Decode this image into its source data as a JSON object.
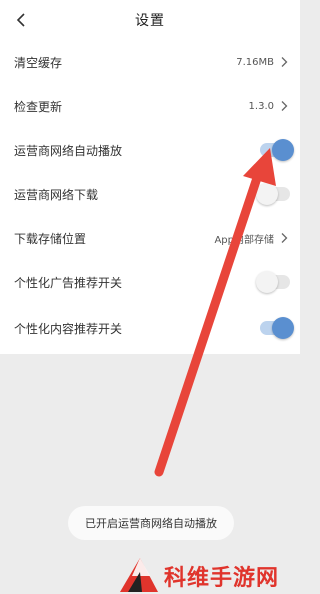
{
  "header": {
    "title": "设置"
  },
  "settings": [
    {
      "label": "清空缓存",
      "type": "value",
      "value": "7.16MB"
    },
    {
      "label": "检查更新",
      "type": "value",
      "value": "1.3.0"
    },
    {
      "label": "运营商网络自动播放",
      "type": "toggle",
      "on": true
    },
    {
      "label": "运营商网络下载",
      "type": "toggle",
      "on": false
    },
    {
      "label": "下载存储位置",
      "type": "value",
      "value": "App内部存储"
    },
    {
      "label": "个性化广告推荐开关",
      "type": "toggle",
      "on": false
    },
    {
      "label": "个性化内容推荐开关",
      "type": "toggle",
      "on": true
    }
  ],
  "toast": {
    "text": "已开启运营商网络自动播放"
  },
  "annotation": {
    "arrow_color": "#e8453a"
  },
  "watermark": {
    "text": "科维手游网"
  },
  "colors": {
    "toggle_on": "#5a8fd0",
    "toggle_track_on": "#bcd3ee",
    "toggle_off": "#f3f3f3"
  }
}
